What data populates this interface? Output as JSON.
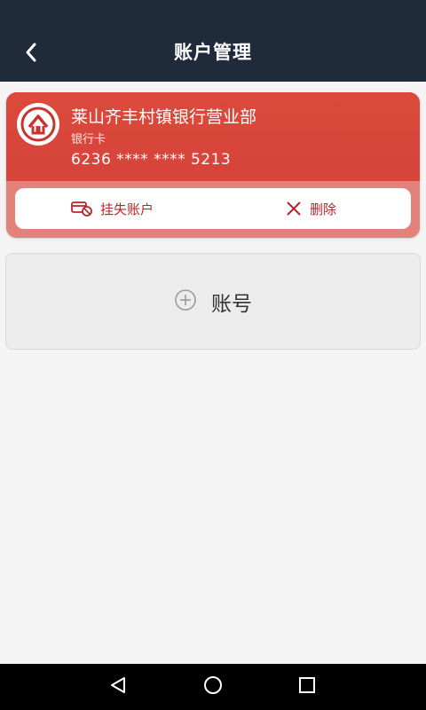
{
  "header": {
    "title": "账户管理",
    "back_icon": "chevron-left-icon",
    "background": "#1f2b3a"
  },
  "account_card": {
    "bank_name": "莱山齐丰村镇银行营业部",
    "card_type": "银行卡",
    "card_number": "6236 **** **** 5213",
    "logo_icon": "bank-logo-icon",
    "card_color": "#d9463b",
    "actions": {
      "report_loss_label": "挂失账户",
      "report_loss_icon": "card-loss-icon",
      "delete_label": "删除",
      "delete_icon": "close-icon",
      "action_color": "#b5262b"
    }
  },
  "add_account": {
    "label": "账号",
    "icon": "plus-circle-icon"
  },
  "system_nav": {
    "back_icon": "triangle-back-icon",
    "home_icon": "circle-home-icon",
    "recent_icon": "square-recent-icon"
  }
}
